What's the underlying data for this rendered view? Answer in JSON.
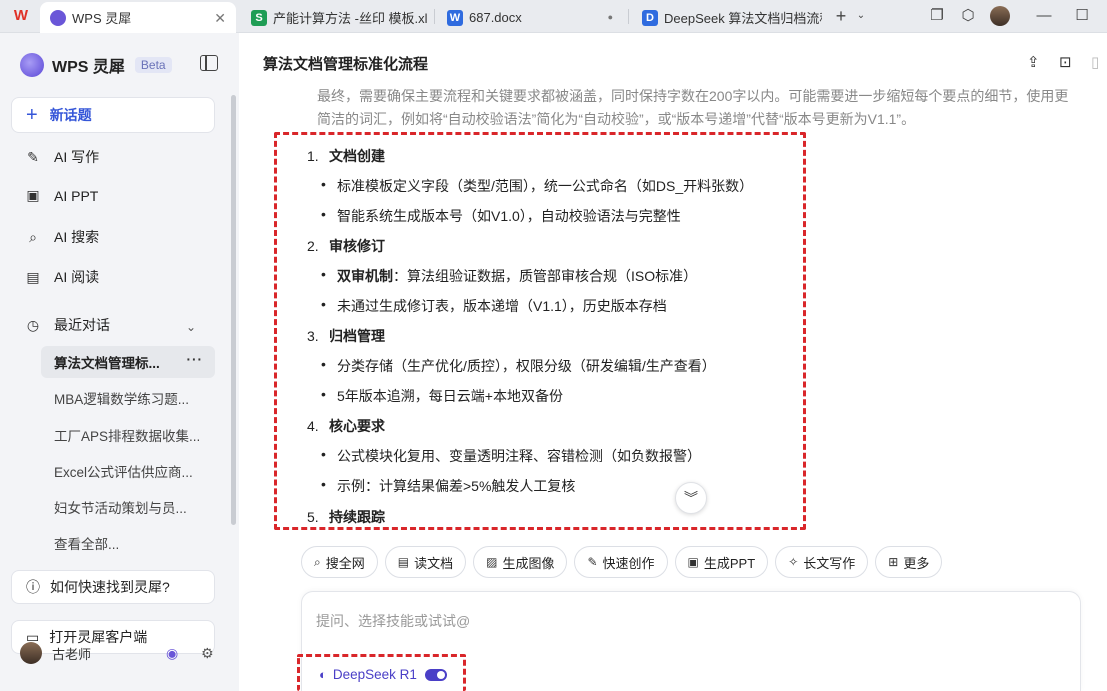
{
  "tabs": [
    {
      "label": "WPS 灵犀",
      "active": true
    },
    {
      "label": "产能计算方法 -丝印 模板.xlsx",
      "icon": "S"
    },
    {
      "label": "687.docx",
      "icon": "W"
    },
    {
      "label": "DeepSeek 算法文档归档流程",
      "icon": "D"
    }
  ],
  "sidebar": {
    "brand": "WPS 灵犀",
    "badge": "Beta",
    "new_topic": "新话题",
    "nav": [
      "AI 写作",
      "AI PPT",
      "AI 搜索",
      "AI 阅读"
    ],
    "recent_label": "最近对话",
    "history": [
      "算法文档管理标...",
      "MBA逻辑数学练习题...",
      "工厂APS排程数据收集...",
      "Excel公式评估供应商...",
      "妇女节活动策划与员...",
      "查看全部..."
    ],
    "help": "如何快速找到灵犀?",
    "open_client": "打开灵犀客户端",
    "user_name": "古老师"
  },
  "main": {
    "title": "算法文档管理标准化流程",
    "faded_text": "最终，需要确保主要流程和关键要求都被涵盖，同时保持字数在200字以内。可能需要进一步缩短每个要点的细节，使用更简洁的词汇，例如将“自动校验语法”简化为“自动校验”，或“版本号递增”代替“版本号更新为V1.1”。",
    "sections": [
      {
        "num": "1.",
        "title": "文档创建",
        "bullets": [
          {
            "text": "标准模板定义字段（类型/范围），统一公式命名（如DS_开料张数）"
          },
          {
            "text": "智能系统生成版本号（如V1.0），自动校验语法与完整性"
          }
        ]
      },
      {
        "num": "2.",
        "title": "审核修订",
        "bullets": [
          {
            "bold": "双审机制",
            "text": "：算法组验证数据，质管部审核合规（ISO标准）"
          },
          {
            "text": "未通过生成修订表，版本递增（V1.1），历史版本存档"
          }
        ]
      },
      {
        "num": "3.",
        "title": "归档管理",
        "bullets": [
          {
            "text": "分类存储（生产优化/质控），权限分级（研发编辑/生产查看）"
          },
          {
            "text": "5年版本追溯，每日云端+本地双备份"
          }
        ]
      },
      {
        "num": "4.",
        "title": "核心要求",
        "bullets": [
          {
            "text": "公式模块化复用、变量透明注释、容错检测（如负数报警）"
          },
          {
            "text": "示例：计算结果偏差>5%触发人工复核"
          }
        ]
      },
      {
        "num": "5.",
        "title": "持续跟踪",
        "bullets": []
      }
    ],
    "skills": [
      "搜全网",
      "读文档",
      "生成图像",
      "快速创作",
      "生成PPT",
      "长文写作",
      "更多"
    ],
    "input_placeholder": "提问、选择技能或试试@",
    "model_name": "DeepSeek R1"
  },
  "colors": {
    "accent": "#3556d8",
    "highlight_border": "#d9262a",
    "model": "#4a3fc7"
  }
}
